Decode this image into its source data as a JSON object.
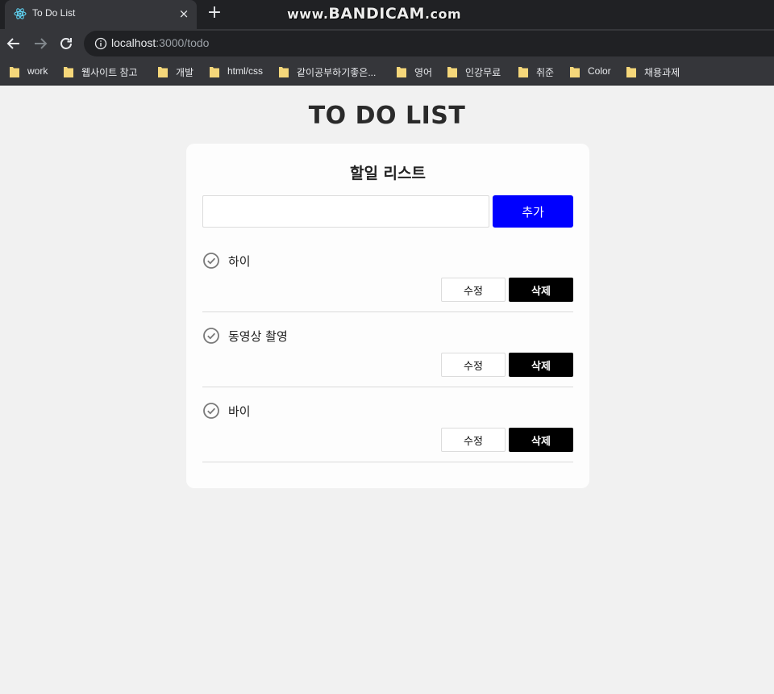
{
  "browser": {
    "tab_title": "To Do List",
    "tab_close": "×",
    "new_tab": "+",
    "watermark_prefix": "www.",
    "watermark_brand": "BANDICAM",
    "watermark_suffix": ".com",
    "url_host": "localhost",
    "url_rest": ":3000/todo",
    "bookmarks": [
      "work",
      "웹사이트 참고",
      "개발",
      "html/css",
      "같이공부하기좋은...",
      "영어",
      "인강무료",
      "취준",
      "Color",
      "채용과제"
    ],
    "colors": {
      "tabbar": "#202124",
      "toolbar": "#35363a",
      "folder": "#f5d77a",
      "react": "#61dafb"
    }
  },
  "page": {
    "title": "TO DO LIST",
    "card_title": "할일 리스트",
    "input_value": "",
    "add_label": "추가",
    "edit_label": "수정",
    "delete_label": "삭제",
    "todos": [
      {
        "text": "하이"
      },
      {
        "text": "동영상 촬영"
      },
      {
        "text": "바이"
      }
    ],
    "colors": {
      "add_button": "#0000ff",
      "delete_button": "#000000",
      "check_icon": "#7a7a7a"
    }
  }
}
